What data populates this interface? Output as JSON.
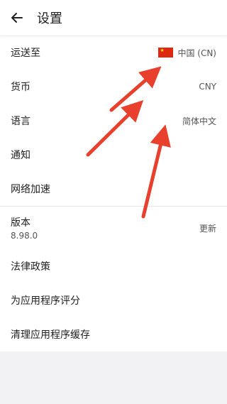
{
  "header": {
    "title": "设置",
    "back_icon": "arrow-left-icon"
  },
  "rows": [
    {
      "label": "运送至",
      "value": "中国 (CN)",
      "flag": "china-flag-icon"
    },
    {
      "label": "货币",
      "value": "CNY"
    },
    {
      "label": "语言",
      "value": "简体中文"
    },
    {
      "label": "通知"
    },
    {
      "label": "网络加速"
    }
  ],
  "version": {
    "label": "版本",
    "number": "8.98.0",
    "action": "更新"
  },
  "more": [
    {
      "label": "法律政策"
    },
    {
      "label": "为应用程序评分"
    },
    {
      "label": "清理应用程序缓存"
    }
  ],
  "colors": {
    "accent_arrows": "#e8402c",
    "flag_red": "#de2910",
    "flag_star": "#ffde00"
  }
}
